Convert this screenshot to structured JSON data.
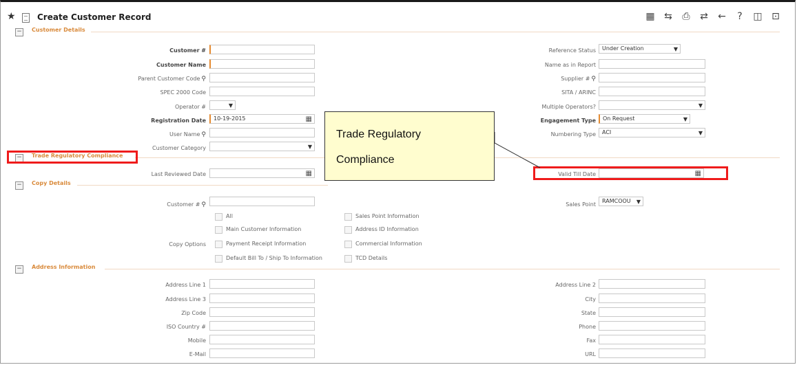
{
  "window": {
    "title": "Create Customer Record"
  },
  "toolbar": [
    {
      "icon": "calculator-icon",
      "glyph": "▦"
    },
    {
      "icon": "shuffle-icon",
      "glyph": "⇆"
    },
    {
      "icon": "print-icon",
      "glyph": "⎙"
    },
    {
      "icon": "repeat-icon",
      "glyph": "⇄"
    },
    {
      "icon": "back-arrow-icon",
      "glyph": "←"
    },
    {
      "icon": "help-icon",
      "glyph": "?"
    },
    {
      "icon": "window-icon",
      "glyph": "◫"
    },
    {
      "icon": "export-icon",
      "glyph": "⊡"
    }
  ],
  "sections": {
    "customer_details": "Customer Details",
    "trade_regulatory_compliance": "Trade Regulatory Compliance",
    "copy_details": "Copy Details",
    "address_information": "Address Information"
  },
  "customer": {
    "customer_no": {
      "label": "Customer #",
      "value": ""
    },
    "customer_name": {
      "label": "Customer Name",
      "value": ""
    },
    "parent_customer_code": {
      "label": "Parent Customer Code",
      "value": ""
    },
    "spec2000": {
      "label": "SPEC 2000 Code",
      "value": ""
    },
    "operator_no": {
      "label": "Operator #",
      "value": ""
    },
    "registration_date": {
      "label": "Registration Date",
      "value": "10-19-2015"
    },
    "user_name": {
      "label": "User Name",
      "value": ""
    },
    "customer_category": {
      "label": "Customer Category",
      "value": ""
    },
    "reference_status": {
      "label": "Reference Status",
      "value": "Under Creation"
    },
    "name_as_in_report": {
      "label": "Name as in Report",
      "value": ""
    },
    "supplier_no": {
      "label": "Supplier #",
      "value": ""
    },
    "sita_arinc": {
      "label": "SITA / ARINC",
      "value": ""
    },
    "multiple_operators": {
      "label": "Multiple Operators?",
      "value": ""
    },
    "engagement_type": {
      "label": "Engagement Type",
      "value": "On Request"
    },
    "numbering_type": {
      "label": "Numbering Type",
      "value": "ACI"
    }
  },
  "trade": {
    "last_reviewed_date": {
      "label": "Last Reviewed Date",
      "value": ""
    },
    "valid_till_date": {
      "label": "Valid Till Date",
      "value": ""
    }
  },
  "copy": {
    "customer_no": {
      "label": "Customer #",
      "value": ""
    },
    "sales_point": {
      "label": "Sales Point",
      "value": "RAMCOOU"
    },
    "copy_options_label": "Copy Options",
    "options_left": [
      "All",
      "Main Customer Information",
      "Payment Receipt Information",
      "Default Bill To / Ship To Information"
    ],
    "options_right": [
      "Sales Point Information",
      "Address ID Information",
      "Commercial Information",
      "TCD Details"
    ]
  },
  "address": {
    "address_line_1": "Address Line 1",
    "address_line_3": "Address Line 3",
    "zip_code": "Zip Code",
    "iso_country": "ISO Country #",
    "mobile": "Mobile",
    "email": "E-Mail",
    "address_line_2": "Address Line 2",
    "city": "City",
    "state": "State",
    "phone": "Phone",
    "fax": "Fax",
    "url": "URL"
  },
  "callout": {
    "line1": "Trade Regulatory",
    "line2": "Compliance"
  },
  "colors": {
    "section_title": "#d98a3b",
    "highlight": "#ef1b1b",
    "callout_bg": "#fffdcf"
  }
}
